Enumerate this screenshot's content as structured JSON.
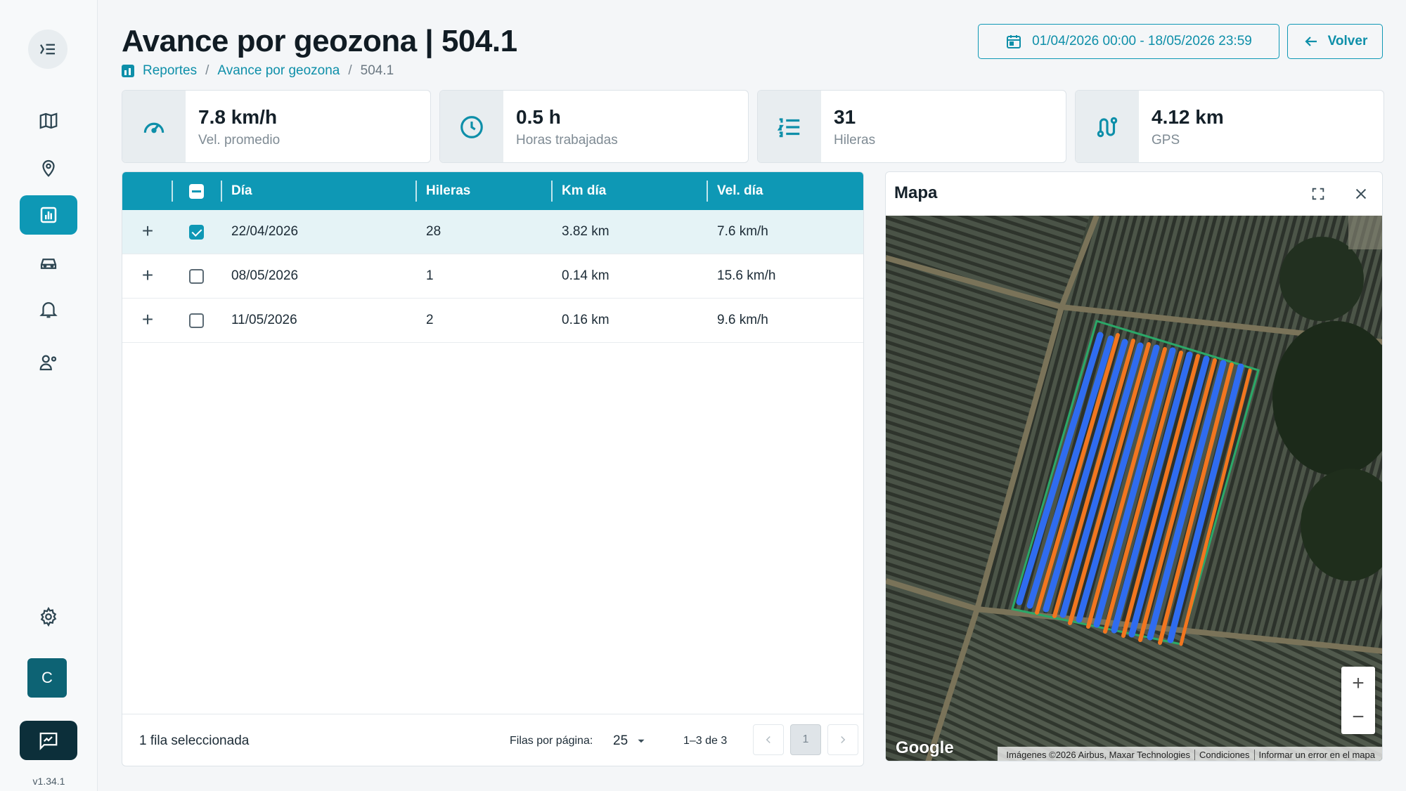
{
  "sidebar": {
    "version": "v1.34.1",
    "avatar_initial": "C",
    "active_item": "reports"
  },
  "header": {
    "title": "Avance por geozona | 504.1",
    "breadcrumb": [
      "Reportes",
      "Avance por geozona",
      "504.1"
    ],
    "date_range": "01/04/2026 00:00 - 18/05/2026 23:59",
    "back_label": "Volver"
  },
  "stats": [
    {
      "value": "7.8 km/h",
      "label": "Vel. promedio",
      "icon": "speedometer-icon"
    },
    {
      "value": "0.5 h",
      "label": "Horas trabajadas",
      "icon": "clock-icon"
    },
    {
      "value": "31",
      "label": "Hileras",
      "icon": "numbered-list-icon"
    },
    {
      "value": "4.12 km",
      "label": "GPS",
      "icon": "route-icon"
    }
  ],
  "table": {
    "columns": [
      "Día",
      "Hileras",
      "Km día",
      "Vel. día"
    ],
    "rows": [
      {
        "day": "22/04/2026",
        "rows": "28",
        "km": "3.82 km",
        "speed": "7.6 km/h",
        "checked": true
      },
      {
        "day": "08/05/2026",
        "rows": "1",
        "km": "0.14 km",
        "speed": "15.6 km/h",
        "checked": false
      },
      {
        "day": "11/05/2026",
        "rows": "2",
        "km": "0.16 km",
        "speed": "9.6 km/h",
        "checked": false
      }
    ],
    "footer": {
      "selected": "1 fila seleccionada",
      "rows_per_page_label": "Filas por página:",
      "rows_per_page": "25",
      "range": "1–3 de 3",
      "current_page": "1"
    }
  },
  "map": {
    "title": "Mapa",
    "attribution": [
      "Imágenes ©2026 Airbus, Maxar Technologies",
      "Condiciones",
      "Informar un error en el mapa"
    ],
    "logo": "Google",
    "track_colors": {
      "blue": "#2f6cf0",
      "orange": "#f2761f"
    }
  },
  "colors": {
    "accent": "#0e98b5",
    "dark": "#0c2f3a"
  }
}
